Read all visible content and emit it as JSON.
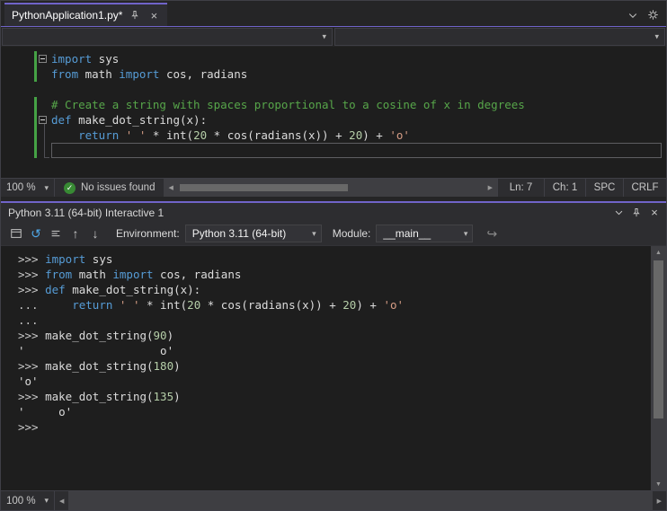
{
  "colors": {
    "accent": "#7064c9",
    "keyword": "#569cd6",
    "string": "#d69d85",
    "number": "#b5cea8",
    "comment": "#57a64a",
    "text": "#dcdcdc",
    "prompt": "#c8c8c8",
    "change_bar": "#45a245",
    "check_green": "#388a34"
  },
  "icons": {
    "close": "×",
    "chevron": "▾",
    "left": "◀",
    "right": "▶",
    "up_triangle": "▲",
    "down_triangle": "▼",
    "history_up": "↑",
    "history_down": "↓",
    "reset": "↺",
    "send": "↪",
    "check": "✓"
  },
  "tab": {
    "title": "PythonApplication1.py*"
  },
  "editor": {
    "lines": [
      {
        "fold": true,
        "changed": true,
        "current": false,
        "tokens": [
          [
            "kw",
            "import"
          ],
          [
            "t",
            " sys"
          ]
        ]
      },
      {
        "fold": false,
        "changed": true,
        "current": false,
        "tokens": [
          [
            "kw",
            "from"
          ],
          [
            "t",
            " math "
          ],
          [
            "kw",
            "import"
          ],
          [
            "t",
            " cos, radians"
          ]
        ]
      },
      {
        "fold": false,
        "changed": false,
        "current": false,
        "tokens": []
      },
      {
        "fold": false,
        "changed": true,
        "current": false,
        "tokens": [
          [
            "com",
            "# Create a string with spaces proportional to a cosine of x in degrees"
          ]
        ]
      },
      {
        "fold": true,
        "changed": true,
        "current": false,
        "tokens": [
          [
            "kw",
            "def"
          ],
          [
            "t",
            " make_dot_string(x):"
          ]
        ]
      },
      {
        "fold": false,
        "changed": true,
        "current": false,
        "tokens": [
          [
            "t",
            "    "
          ],
          [
            "kw",
            "return"
          ],
          [
            "t",
            " "
          ],
          [
            "str",
            "' '"
          ],
          [
            "t",
            " * int("
          ],
          [
            "num",
            "20"
          ],
          [
            "t",
            " * cos(radians(x)) + "
          ],
          [
            "num",
            "20"
          ],
          [
            "t",
            ") + "
          ],
          [
            "str",
            "'o'"
          ]
        ]
      },
      {
        "fold": false,
        "changed": true,
        "current": true,
        "tokens": []
      }
    ],
    "status": {
      "zoom": "100 %",
      "issues": "No issues found",
      "ln": "Ln: 7",
      "ch": "Ch: 1",
      "spc": "SPC",
      "crlf": "CRLF"
    }
  },
  "interactive": {
    "title": "Python 3.11 (64-bit) Interactive 1",
    "toolbar": {
      "environment_label": "Environment:",
      "environment_value": "Python 3.11 (64-bit)",
      "module_label": "Module:",
      "module_value": "__main__"
    },
    "lines": [
      [
        [
          "p",
          ">>> "
        ],
        [
          "kw",
          "import"
        ],
        [
          "t",
          " sys"
        ]
      ],
      [
        [
          "p",
          ">>> "
        ],
        [
          "kw",
          "from"
        ],
        [
          "t",
          " math "
        ],
        [
          "kw",
          "import"
        ],
        [
          "t",
          " cos, radians"
        ]
      ],
      [
        [
          "p",
          ">>> "
        ],
        [
          "kw",
          "def"
        ],
        [
          "t",
          " make_dot_string(x):"
        ]
      ],
      [
        [
          "p",
          "... "
        ],
        [
          "t",
          "    "
        ],
        [
          "kw",
          "return"
        ],
        [
          "t",
          " "
        ],
        [
          "str",
          "' '"
        ],
        [
          "t",
          " * int("
        ],
        [
          "num",
          "20"
        ],
        [
          "t",
          " * cos(radians(x)) + "
        ],
        [
          "num",
          "20"
        ],
        [
          "t",
          ") + "
        ],
        [
          "str",
          "'o'"
        ]
      ],
      [
        [
          "p",
          "..."
        ]
      ],
      [
        [
          "p",
          ">>> "
        ],
        [
          "t",
          "make_dot_string("
        ],
        [
          "num",
          "90"
        ],
        [
          "t",
          ")"
        ]
      ],
      [
        [
          "t",
          "'                    o'"
        ]
      ],
      [
        [
          "p",
          ">>> "
        ],
        [
          "t",
          "make_dot_string("
        ],
        [
          "num",
          "180"
        ],
        [
          "t",
          ")"
        ]
      ],
      [
        [
          "t",
          "'o'"
        ]
      ],
      [
        [
          "p",
          ">>> "
        ],
        [
          "t",
          "make_dot_string("
        ],
        [
          "num",
          "135"
        ],
        [
          "t",
          ")"
        ]
      ],
      [
        [
          "t",
          "'     o'"
        ]
      ],
      [
        [
          "p",
          ">>>"
        ]
      ]
    ],
    "zoom": "100 %"
  }
}
